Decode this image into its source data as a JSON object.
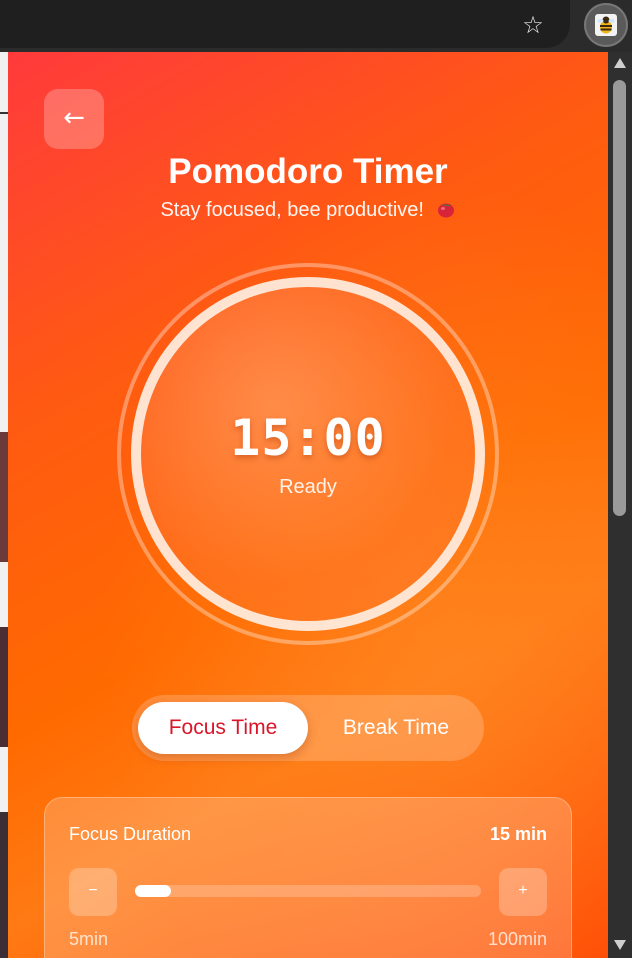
{
  "browser": {
    "bookmark_icon": "star-icon",
    "extension_icon": "bee-icon"
  },
  "popup": {
    "back_label": "←",
    "title": "Pomodoro Timer",
    "subtitle": "Stay focused, bee productive!",
    "subtitle_icon": "tomato-icon",
    "timer": {
      "time": "15:00",
      "status": "Ready"
    },
    "modes": {
      "focus_label": "Focus Time",
      "break_label": "Break Time",
      "selected": "Focus Time"
    },
    "duration": {
      "label": "Focus Duration",
      "value": "15 min",
      "minus_label": "−",
      "plus_label": "+",
      "min_label": "5min",
      "max_label": "100min",
      "slider_fraction": 0.105
    },
    "colors": {
      "gradient_start": "#ff3a3c",
      "gradient_end": "#ff7a14",
      "active_tab_text": "#d9162a"
    }
  }
}
